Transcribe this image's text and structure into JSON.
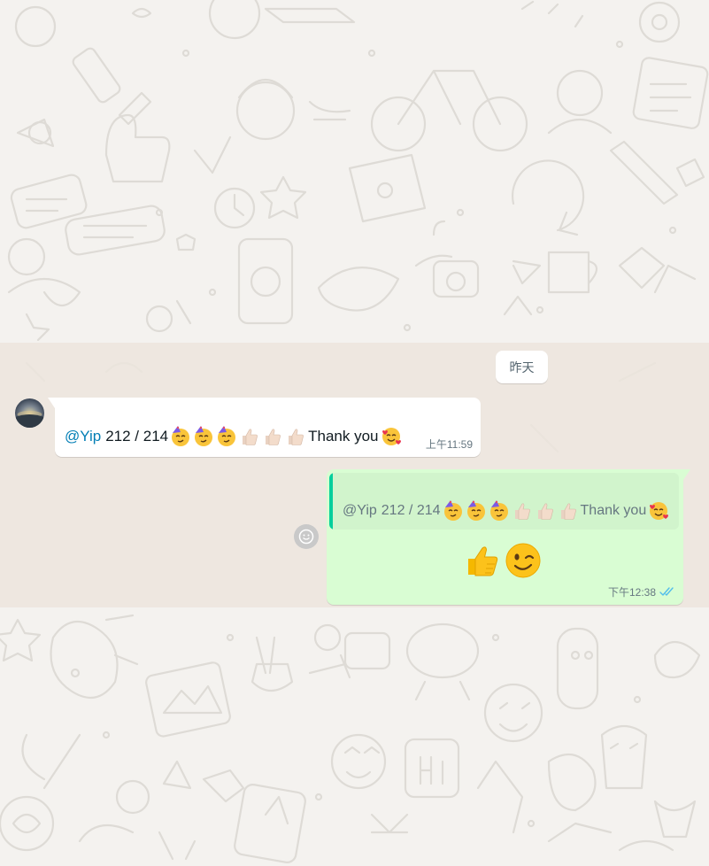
{
  "date_divider": "昨天",
  "incoming": {
    "mention": "@Yip",
    "text": "212 / 214",
    "suffix": "Thank you",
    "time": "上午11:59",
    "emojis": [
      "partying-face",
      "partying-face",
      "partying-face",
      "thumbs-up",
      "thumbs-up",
      "thumbs-up",
      "smiling-face-with-hearts"
    ]
  },
  "outgoing": {
    "quote": {
      "mention": "@Yip",
      "text": "212 / 214",
      "suffix": "Thank you"
    },
    "emojis": [
      "thumbs-up",
      "winking-face"
    ],
    "time": "下午12:38",
    "status_icon": "double-check-icon"
  },
  "colors": {
    "incoming_bubble": "#ffffff",
    "outgoing_bubble": "#d9fdd3",
    "quote_bar": "#06cf9c",
    "mention": "#027eb5",
    "read_tick": "#53bdeb"
  }
}
